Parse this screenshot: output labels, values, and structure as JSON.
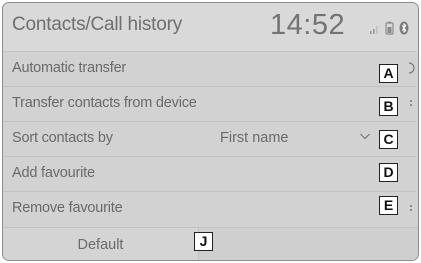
{
  "header": {
    "title": "Contacts/Call history",
    "time": "14:52",
    "status_icons": [
      "signal-icon",
      "battery-icon",
      "bluetooth-icon"
    ]
  },
  "settings": [
    {
      "label": "Automatic transfer",
      "callout": "A"
    },
    {
      "label": "Transfer contacts from device",
      "callout": "B"
    },
    {
      "label": "Sort contacts by",
      "value": "First name",
      "callout": "C",
      "icon": "chevron-down-icon"
    },
    {
      "label": "Add favourite",
      "callout": "D"
    },
    {
      "label": "Remove favourite",
      "callout": "E"
    }
  ],
  "footer": {
    "default_label": "Default",
    "default_callout": "J"
  },
  "colors": {
    "screen_background": "#d2d2d2",
    "text": "#6a6a6a",
    "divider": "#c2c2c2"
  }
}
